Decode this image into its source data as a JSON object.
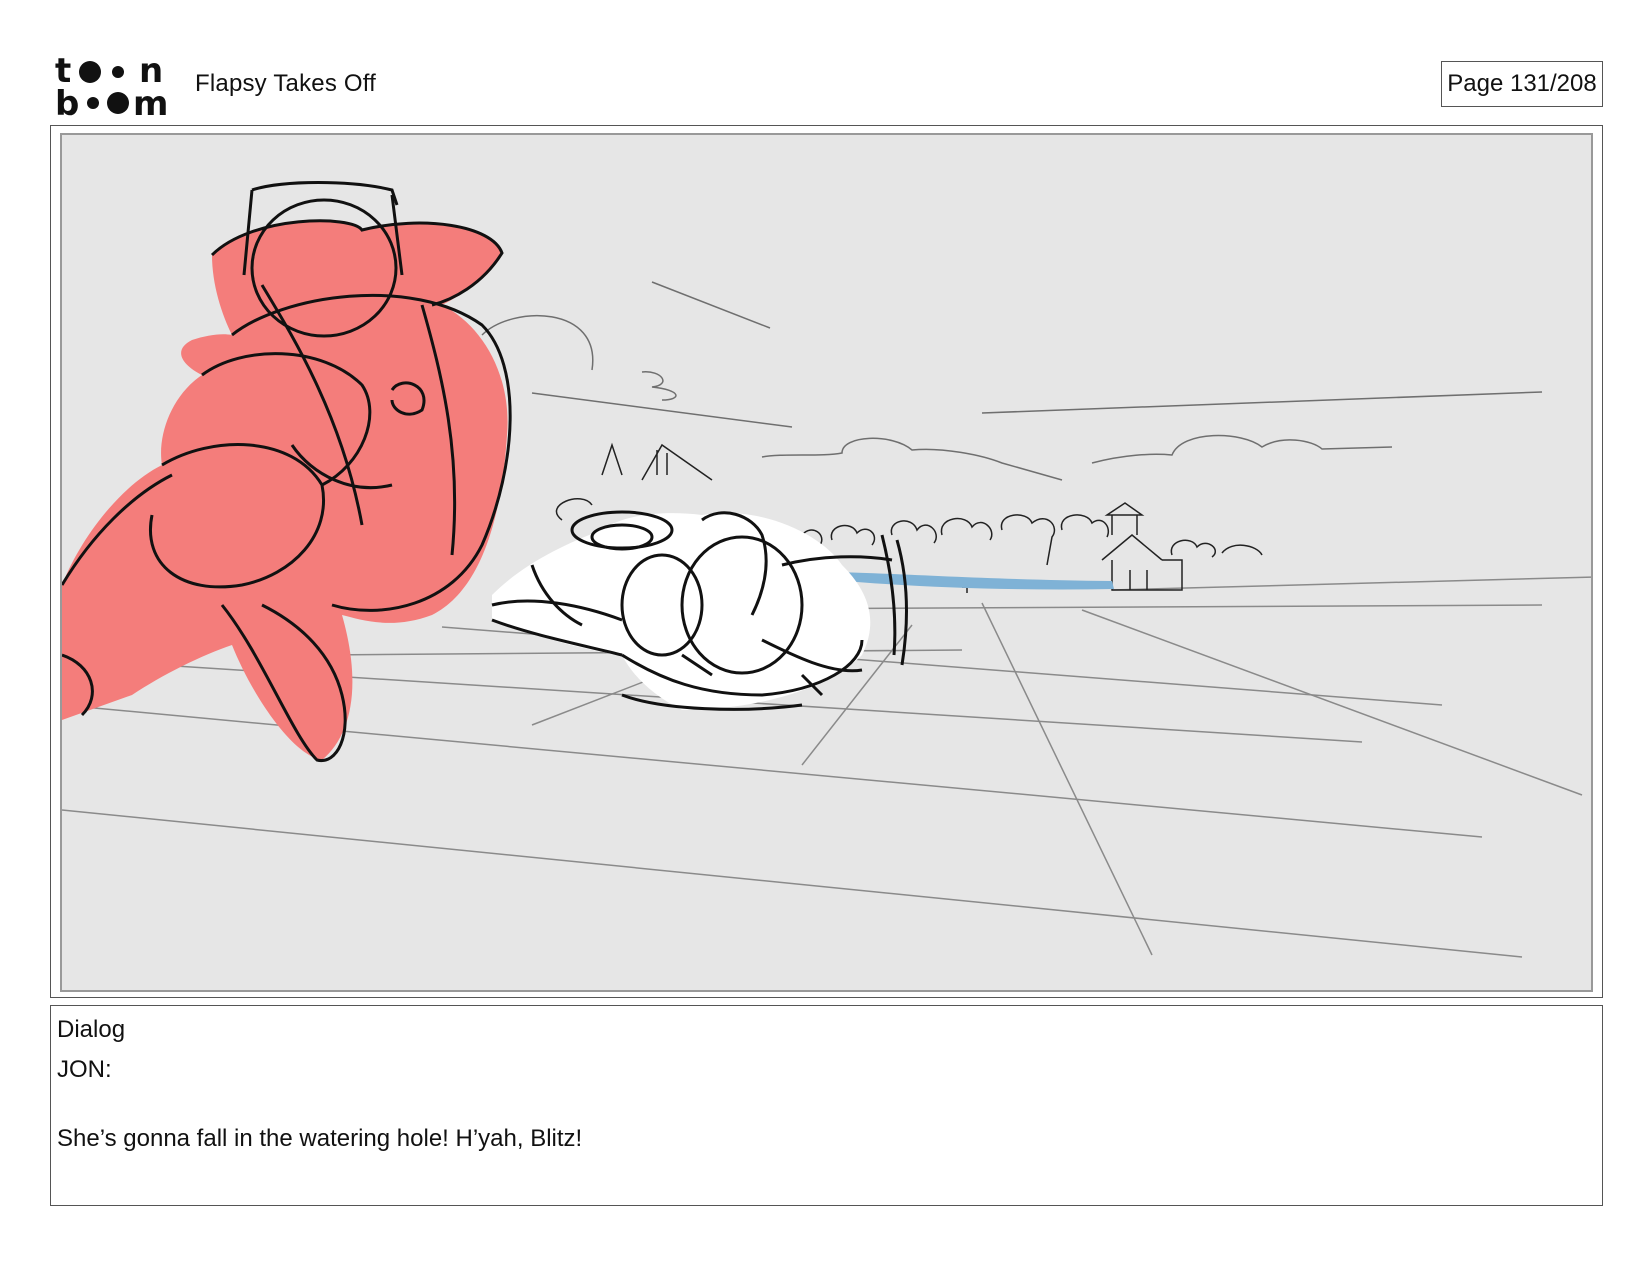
{
  "header": {
    "logo_top": "to•n",
    "logo_bottom": "b••m",
    "project_title": "Flapsy Takes Off",
    "page_indicator": "Page 131/208"
  },
  "dialog": {
    "heading": "Dialog",
    "speaker": "JON:",
    "line": "She’s gonna fall in the watering hole! H’yah, Blitz!"
  },
  "colors": {
    "panel_background": "#e6e6e6",
    "character_fill": "#f47d7b",
    "water": "#7fb2d6",
    "ink": "#111111"
  }
}
